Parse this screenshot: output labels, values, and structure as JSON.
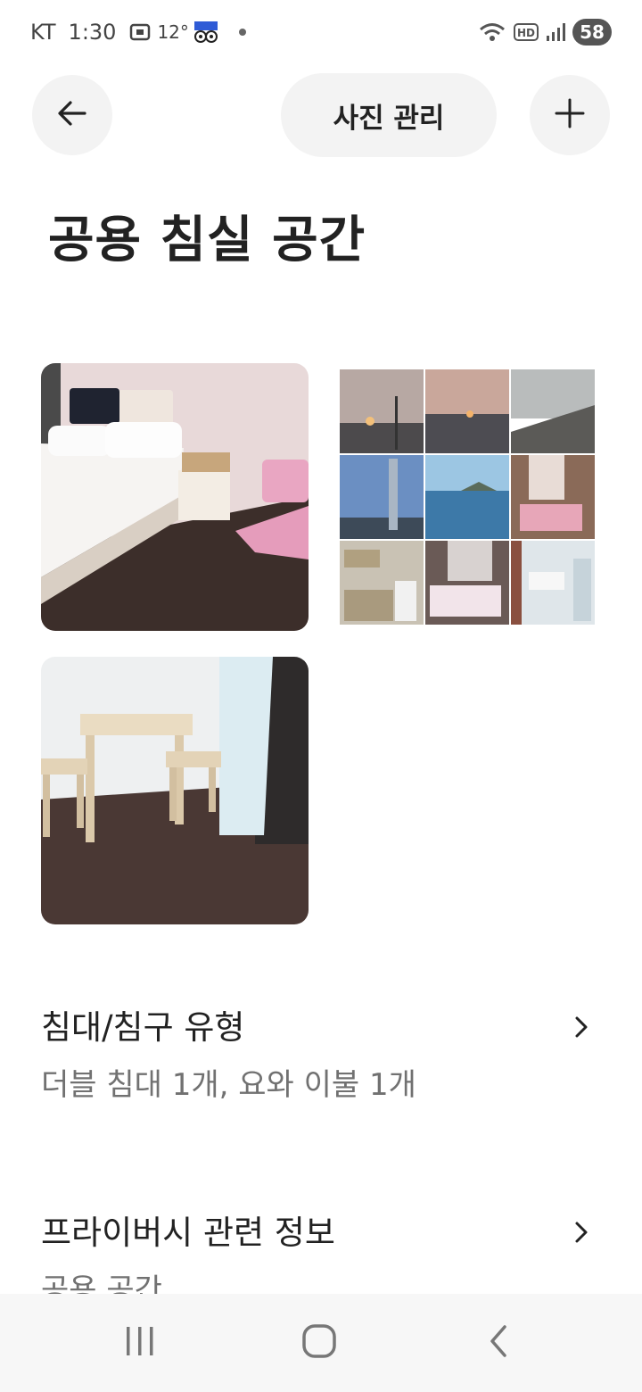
{
  "status_bar": {
    "carrier": "KT",
    "time": "1:30",
    "temperature": "12°",
    "battery": "58",
    "icons": [
      "screen-record-icon",
      "weather-app-icon",
      "notification-dot-icon",
      "wifi-icon",
      "hd-voice-icon",
      "signal-icon",
      "battery-icon"
    ]
  },
  "header": {
    "back_icon": "arrow-left-icon",
    "manage_photos_label": "사진 관리",
    "add_icon": "plus-icon"
  },
  "page": {
    "title": "공용 침실 공간"
  },
  "photos": {
    "main_1": "bedroom-photo",
    "collage": "photo-collage",
    "main_2": "table-chairs-photo"
  },
  "rows": [
    {
      "title": "침대/침구 유형",
      "value": "더블 침대 1개, 요와 이불  1개"
    },
    {
      "title": "프라이버시 관련 정보",
      "value": "공용 공간"
    }
  ],
  "nav": {
    "recent_icon": "recent-apps-icon",
    "home_icon": "home-icon",
    "back_icon": "back-icon"
  },
  "colors": {
    "button_bg": "#f3f3f3",
    "text_primary": "#222222",
    "text_secondary": "#717171",
    "nav_bg": "#f7f7f7"
  }
}
